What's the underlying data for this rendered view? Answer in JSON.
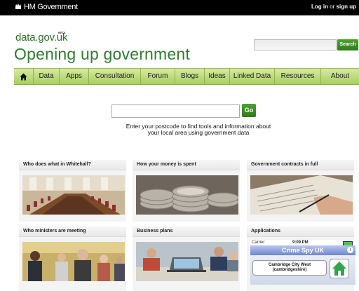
{
  "header": {
    "government": "HM Government",
    "login_text": "Log in",
    "or_text": " or ",
    "signup_text": "sign up"
  },
  "brand": {
    "site_name": "data.gov.uk",
    "beta": "BETA",
    "tagline": "Opening up government"
  },
  "search": {
    "button_label": "Search",
    "value": ""
  },
  "nav": {
    "items": [
      {
        "label": "Data"
      },
      {
        "label": "Apps"
      },
      {
        "label": "Consultation"
      },
      {
        "label": "Forum"
      },
      {
        "label": "Blogs"
      },
      {
        "label": "Ideas"
      },
      {
        "label": "Linked Data"
      },
      {
        "label": "Resources"
      },
      {
        "label": "About"
      }
    ]
  },
  "postcode": {
    "value": "",
    "button_label": "Go",
    "help_line1": "Enter your postcode to find tools and information about",
    "help_line2": "your local area using government data"
  },
  "tiles": [
    {
      "title": "Who does what in Whitehall?",
      "image": "conference-room-photo"
    },
    {
      "title": "How your money is spent",
      "image": "coins-photo"
    },
    {
      "title": "Government contracts in full",
      "image": "signing-document-photo"
    },
    {
      "title": "Who ministers are meeting",
      "image": "meeting-people-photo"
    },
    {
      "title": "Business plans",
      "image": "laptop-meeting-photo"
    },
    {
      "title": "Applications",
      "image": "phone-app-screenshot"
    }
  ],
  "app_screenshot": {
    "carrier": "Carrier",
    "time": "9:09 PM",
    "app_name": "Crime Spy UK",
    "location_line1": "Cambridge City West",
    "location_line2": "(cambridgeshire)"
  },
  "colors": {
    "brand_green": "#2f7d2f",
    "nav_green": "#a9cf5e",
    "button_green": "#3a8f23",
    "topbar": "#000000"
  }
}
